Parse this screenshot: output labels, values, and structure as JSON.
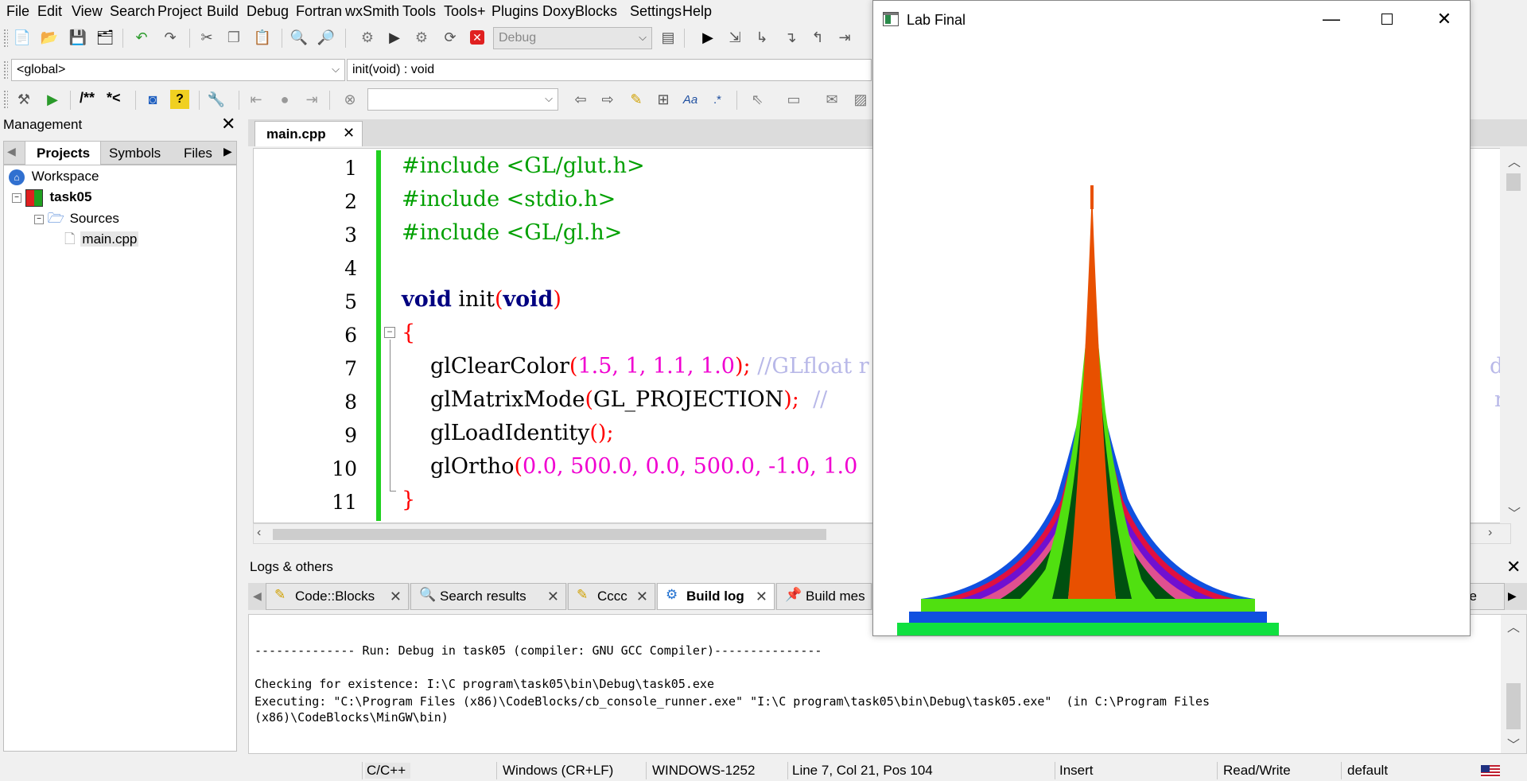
{
  "menubar": {
    "items": [
      "File",
      "Edit",
      "View",
      "Search",
      "Project",
      "Build",
      "Debug",
      "Fortran",
      "wxSmith",
      "Tools",
      "Tools+",
      "Plugins",
      "DoxyBlocks",
      "Settings",
      "Help"
    ]
  },
  "toolbar": {
    "build_target": "Debug",
    "scope": "<global>",
    "function": "init(void) : void",
    "doxy_block": "/**",
    "doxy_line": "*<",
    "search_value": ""
  },
  "management": {
    "title": "Management",
    "tabs": [
      "Projects",
      "Symbols",
      "Files"
    ],
    "active_tab": "Projects",
    "tree": {
      "workspace": "Workspace",
      "project": "task05",
      "folder": "Sources",
      "file": "main.cpp"
    }
  },
  "editor": {
    "tab_label": "main.cpp",
    "lines": [
      "1",
      "2",
      "3",
      "4",
      "5",
      "6",
      "7",
      "8",
      "9",
      "10",
      "11"
    ],
    "code": {
      "l1": "#include <GL/glut.h>",
      "l2": "#include <stdio.h>",
      "l3": "#include <GL/gl.h>",
      "l5_kw1": "void",
      "l5_fn": " init",
      "l5_p1": "(",
      "l5_kw2": "void",
      "l5_p2": ")",
      "l6": "{",
      "l7_fn": "glClearColor",
      "l7_args": "1.5, 1, 1.1, 1.0",
      "l7_cm": "//GLfloat r",
      "l7_cm_right": "d l",
      "l8_fn": "glMatrixMode",
      "l8_arg": "GL_PROJECTION",
      "l8_cm": "//",
      "l8_cm_right": "ro",
      "l9_fn": "glLoadIdentity",
      "l10_fn": "glOrtho",
      "l10_args": "0.0, 500.0, 0.0, 500.0, -1.0, 1.0",
      "l11": "}"
    }
  },
  "logs": {
    "title": "Logs & others",
    "tabs": [
      "Code::Blocks",
      "Search results",
      "Cccc",
      "Build log",
      "Build mes"
    ],
    "active_tab": "Build log",
    "right_tab_fragment": "pe",
    "output": [
      "",
      "-------------- Run: Debug in task05 (compiler: GNU GCC Compiler)---------------",
      "",
      "Checking for existence: I:\\C program\\task05\\bin\\Debug\\task05.exe",
      "Executing: \"C:\\Program Files (x86)\\CodeBlocks/cb_console_runner.exe\" \"I:\\C program\\task05\\bin\\Debug\\task05.exe\"  (in C:\\Program Files",
      "(x86)\\CodeBlocks\\MinGW\\bin)"
    ]
  },
  "status": {
    "language": "C/C++",
    "eol": "Windows (CR+LF)",
    "encoding": "WINDOWS-1252",
    "position": "Line 7, Col 21, Pos 104",
    "mode": "Insert",
    "access": "Read/Write",
    "profile": "default"
  },
  "lab_window": {
    "title": "Lab Final",
    "colors": {
      "orange": "#e85000",
      "lime": "#50e010",
      "dark_green": "#005010",
      "pink": "#e05090",
      "purple": "#7010d0",
      "red": "#e01040",
      "blue": "#1050e0",
      "green": "#10e040"
    }
  }
}
